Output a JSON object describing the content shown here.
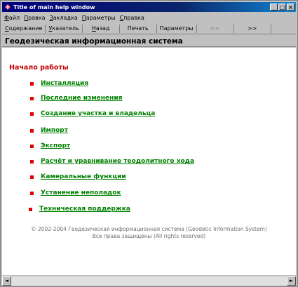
{
  "window": {
    "title": "Title of main help window",
    "minimize": "_",
    "maximize": "□",
    "close": "×"
  },
  "menu": {
    "items": [
      {
        "accel": "Ф",
        "rest": "айл"
      },
      {
        "accel": "П",
        "rest": "равка"
      },
      {
        "accel": "З",
        "rest": "акладка"
      },
      {
        "accel": "П",
        "rest": "араметры"
      },
      {
        "accel": "С",
        "rest": "правка"
      }
    ]
  },
  "toolbar": {
    "buttons": [
      {
        "accel": "С",
        "rest": "одержание"
      },
      {
        "accel": "У",
        "rest": "казатель"
      },
      {
        "accel": "Н",
        "rest": "азад"
      },
      {
        "accel": "",
        "rest": "Печать"
      },
      {
        "accel": "",
        "rest": "Параметры"
      },
      {
        "accel": "",
        "rest": "<<"
      },
      {
        "accel": "",
        "rest": ">>"
      }
    ]
  },
  "header": {
    "title": "Геодезическая информационная система"
  },
  "content": {
    "section_heading": "Начало работы",
    "links": [
      "Инсталляция",
      "Последние изменения",
      "Создание участка и владельца",
      "Импорт",
      "Экспорт",
      "Расчёт и уравнивание теодолитного хода",
      "Камеральные функции",
      "Устанение неполадок",
      "Техническая поддержка"
    ],
    "footer_line1": "© 2002-2004 Геодезическая информационная система (Geodetic Information System)",
    "footer_line2": "Все права защищены (All rights reserved)"
  },
  "scrollbar": {
    "left_arrow": "◄",
    "right_arrow": "►"
  }
}
